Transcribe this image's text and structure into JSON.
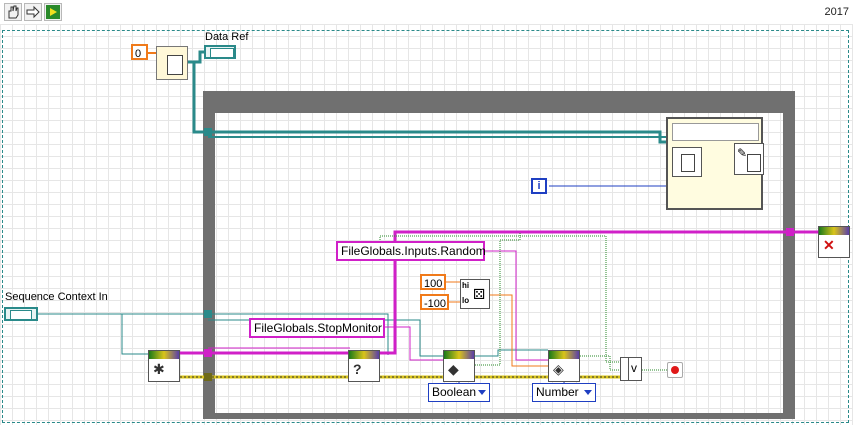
{
  "toolbar": {
    "year": "2017"
  },
  "diagram": {
    "labels": {
      "data_ref": "Data Ref",
      "sequence_context": "Sequence Context In"
    },
    "constants": {
      "zero": "0",
      "iteration": "i",
      "hi": "100",
      "lo": "-100"
    },
    "properties": {
      "random": "FileGlobals.Inputs.Random",
      "stop_monitor": "FileGlobals.StopMonitor"
    },
    "rings": {
      "boolean": "Boolean",
      "number": "Number"
    },
    "random_terminals": {
      "hi": "hi",
      "lo": "lo"
    },
    "or_gate": "v"
  },
  "colors": {
    "cluster_wire": "#2a8a8a",
    "numeric_wire": "#1f3fc2",
    "string_wire": "#d020c8",
    "error_wire": "#d9c41a",
    "loop_border": "#707070",
    "orange_const": "#f07a1a"
  }
}
